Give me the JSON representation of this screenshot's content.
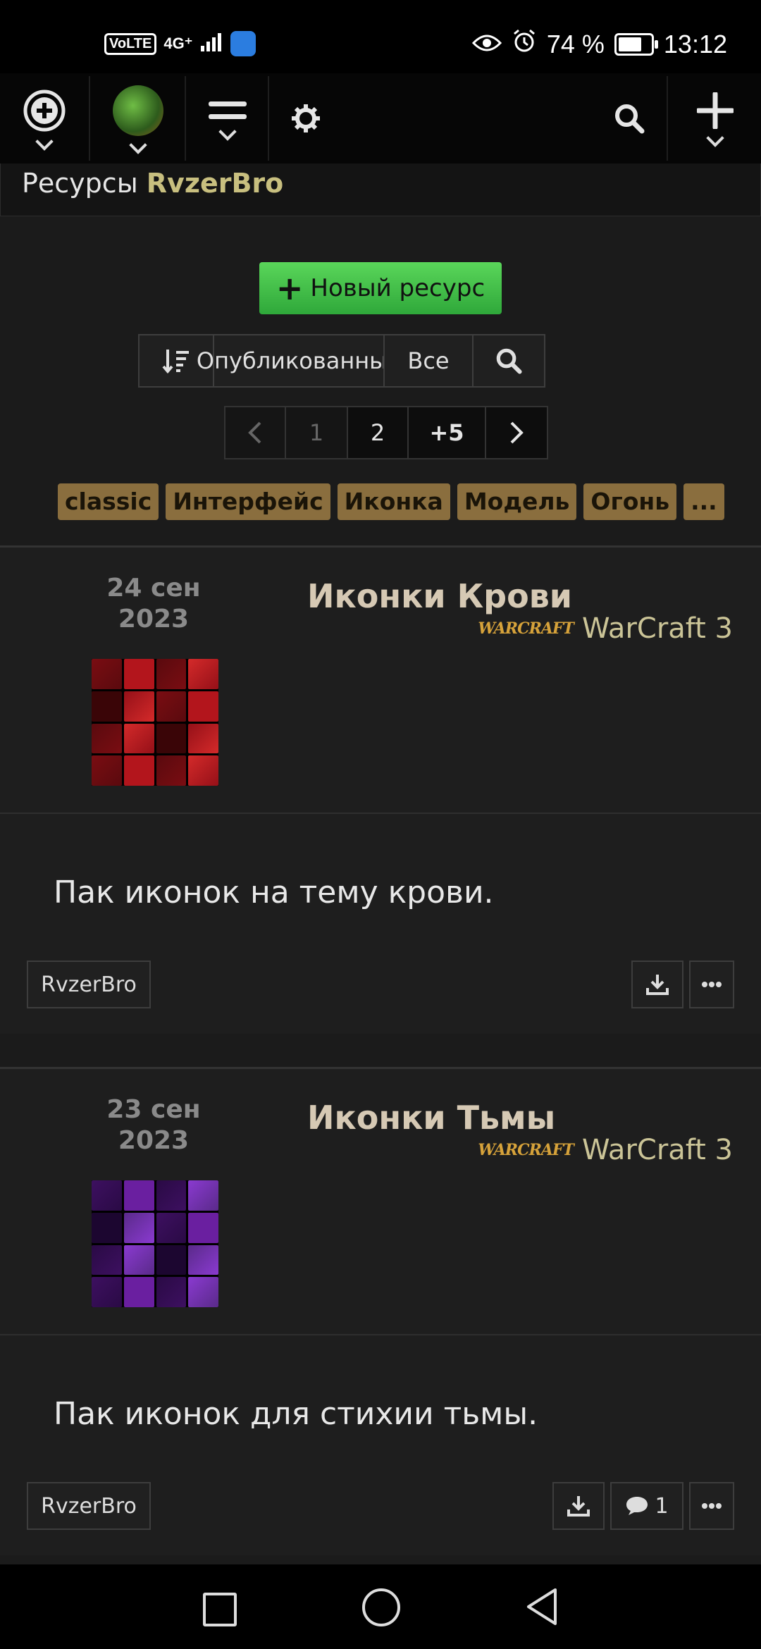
{
  "status_bar": {
    "left_badge": "VoLTE",
    "signal": "4G⁺",
    "battery_text": "74 %",
    "battery_level": 0.74,
    "time": "13:12"
  },
  "header": {
    "title_prefix": "Ресурсы",
    "user": "RvzerBro"
  },
  "new_resource_label": "Новый ресурс",
  "filters": {
    "published": "Опубликованные",
    "all": "Все"
  },
  "pagination": {
    "pages": [
      "1",
      "2",
      "+5"
    ],
    "current": "2"
  },
  "tags": [
    "classic",
    "Интерфейс",
    "Иконка",
    "Модель",
    "Огонь",
    "..."
  ],
  "resources": [
    {
      "date_day": "24 сен",
      "date_year": "2023",
      "title": "Иконки Крови",
      "game": "WarCraft 3",
      "game_logo": "WARCRAFT",
      "description": "Пак иконок на тему крови.",
      "author": "RvzerBro",
      "comments": null
    },
    {
      "date_day": "23 сен",
      "date_year": "2023",
      "title": "Иконки Тьмы",
      "game": "WarCraft 3",
      "game_logo": "WARCRAFT",
      "description": "Пак иконок для стихии тьмы.",
      "author": "RvzerBro",
      "comments": "1"
    }
  ],
  "icons": {
    "add_circle": "plus-circle-icon",
    "menu": "hamburger-icon",
    "settings": "gear-icon",
    "search": "search-icon",
    "add": "plus-icon",
    "sort": "sort-icon",
    "download": "download-icon",
    "comment": "comment-icon",
    "more": "more-icon"
  },
  "colors": {
    "accent_green": "#3cc24a",
    "tag_bg": "#8a6e3e",
    "username": "#c8bf7f",
    "game_text": "#cbc497"
  }
}
